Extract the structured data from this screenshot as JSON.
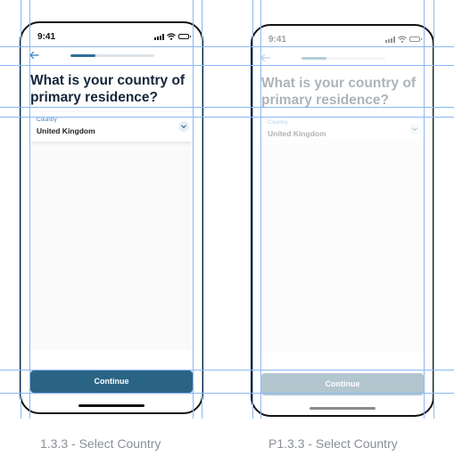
{
  "screens": [
    {
      "status_time": "9:41",
      "progress": 0.3,
      "title": "What is your country of primary residence?",
      "field_label": "Country",
      "field_value": "United Kingdom",
      "button_label": "Continue",
      "caption": "1.3.3 - Select Country"
    },
    {
      "status_time": "9:41",
      "progress": 0.3,
      "title": "What is your country of primary residence?",
      "field_label": "Country",
      "field_value": "United Kingdom",
      "button_label": "Continue",
      "caption": "P1.3.3 - Select Country"
    }
  ],
  "colors": {
    "accent": "#2a6485",
    "label_blue": "#2f7fc0",
    "guide": "#8ab8f4"
  },
  "icons": [
    "back-arrow-icon",
    "signal-icon",
    "wifi-icon",
    "battery-icon",
    "chevron-down-icon"
  ]
}
